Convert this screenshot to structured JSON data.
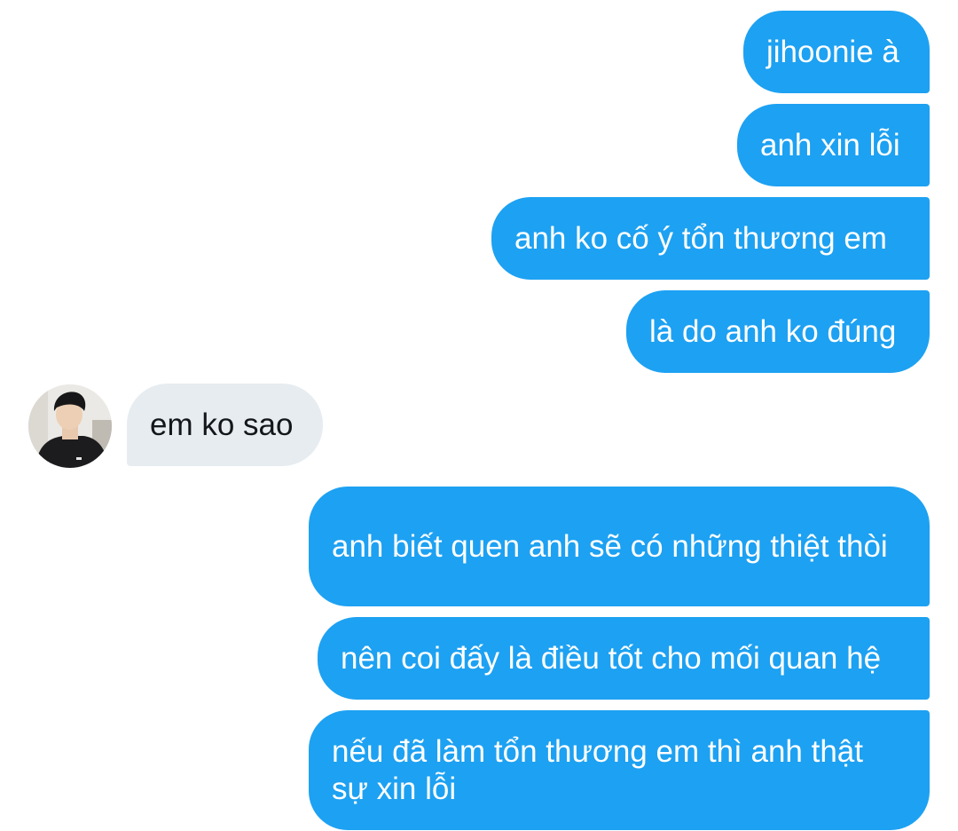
{
  "conversation": {
    "messages": [
      {
        "from": "me",
        "text": "jihoonie à"
      },
      {
        "from": "me",
        "text": "anh xin lỗi"
      },
      {
        "from": "me",
        "text": "anh ko cố ý tổn thương em"
      },
      {
        "from": "me",
        "text": "là do anh ko đúng"
      },
      {
        "from": "other",
        "text": "em ko sao"
      },
      {
        "from": "me",
        "text": "anh biết quen anh sẽ có những thiệt thòi"
      },
      {
        "from": "me",
        "text": "nên coi đấy là điều tốt cho mối quan hệ"
      },
      {
        "from": "me",
        "text": "nếu đã làm tổn thương em thì anh thật sự xin lỗi"
      }
    ]
  },
  "colors": {
    "sent_bubble": "#1da1f2",
    "received_bubble": "#e6ecf0"
  },
  "icons": {
    "avatar": "user-avatar-photo"
  }
}
